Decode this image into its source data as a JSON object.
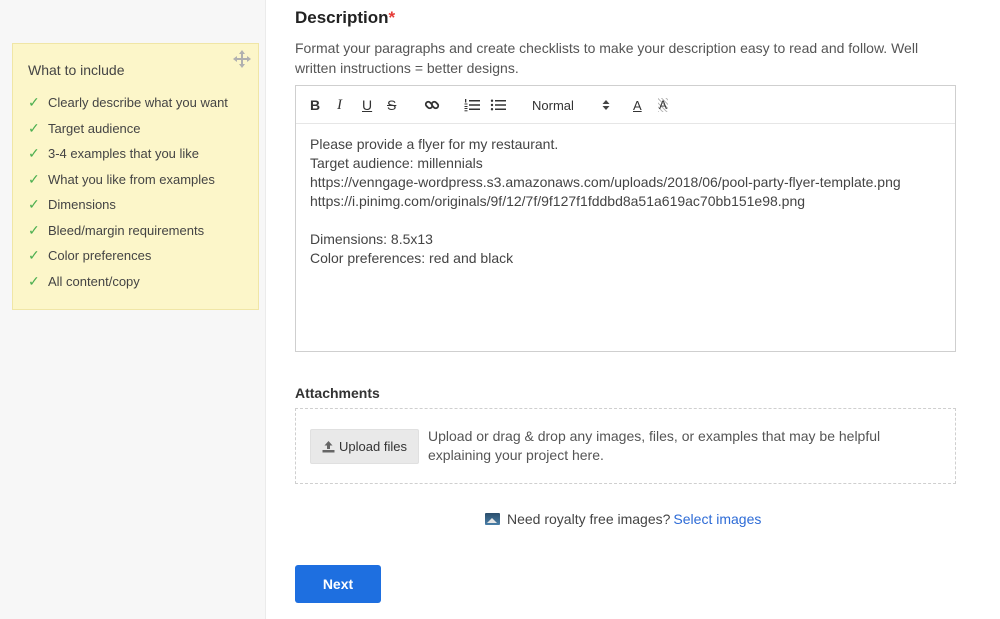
{
  "tips": {
    "title": "What to include",
    "items": [
      "Clearly describe what you want",
      "Target audience",
      "3-4 examples that you like",
      "What you like from examples",
      "Dimensions",
      "Bleed/margin requirements",
      "Color preferences",
      "All content/copy"
    ]
  },
  "description": {
    "title": "Description",
    "required_mark": "*",
    "help": "Format your paragraphs and create checklists to make your description easy to read and follow. Well written instructions = better designs.",
    "toolbar": {
      "bold": "B",
      "italic": "I",
      "underline": "U",
      "strike": "S",
      "size": "Normal",
      "color": "A",
      "background": "A"
    },
    "content": "Please provide a flyer for my restaurant.\nTarget audience: millennials\nhttps://venngage-wordpress.s3.amazonaws.com/uploads/2018/06/pool-party-flyer-template.png\nhttps://i.pinimg.com/originals/9f/12/7f/9f127f1fddbd8a51a619ac70bb151e98.png\n\nDimensions: 8.5x13\nColor preferences: red and black"
  },
  "attachments": {
    "title": "Attachments",
    "upload_label": "Upload files",
    "help": "Upload or drag & drop any images, files, or examples that may be helpful explaining your project here."
  },
  "royalty": {
    "text": "Need royalty free images?",
    "link": "Select images"
  },
  "next_label": "Next",
  "colors": {
    "accent": "#1e6fe0",
    "tip_bg": "#fcf6c9",
    "check": "#4caf50",
    "required": "#e53935"
  }
}
